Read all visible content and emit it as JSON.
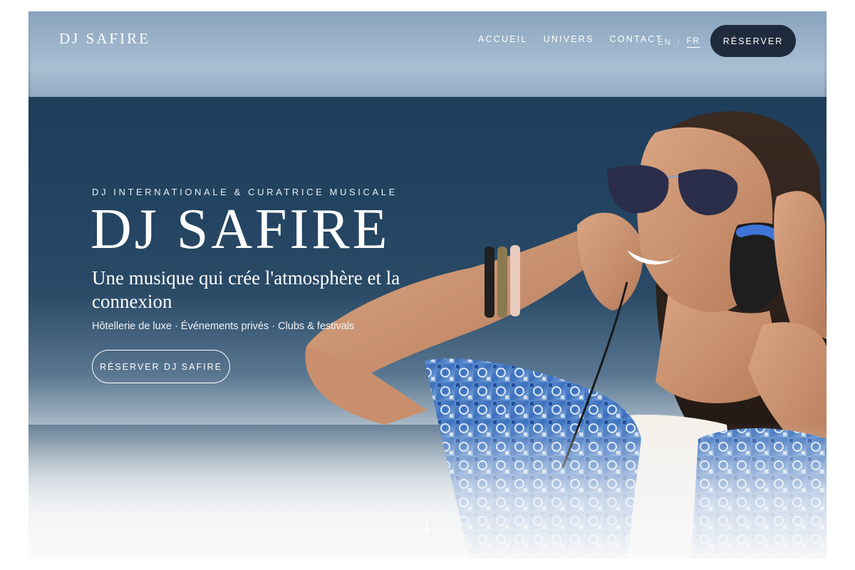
{
  "header": {
    "logo": "DJ SAFIRE",
    "nav": [
      "ACCUEIL",
      "UNIVERS",
      "CONTACT"
    ],
    "languages": [
      "EN",
      "FR"
    ],
    "language_separator": "/",
    "active_language": "FR",
    "reserve_label": "RÉSERVER"
  },
  "hero": {
    "eyebrow": "DJ INTERNATIONALE & CURATRICE MUSICALE",
    "title": "DJ SAFIRE",
    "tagline": "Une musique qui crée l'atmosphère et la connexion",
    "services": "Hôtellerie de luxe · Événements privés · Clubs & festivals",
    "cta_label": "RÉSERVER DJ SAFIRE"
  },
  "colors": {
    "accent_dark": "#1f2b3d",
    "ocean": "#23425f",
    "text": "#ffffff"
  },
  "icons": {
    "scroll": "arrow-down-icon"
  }
}
